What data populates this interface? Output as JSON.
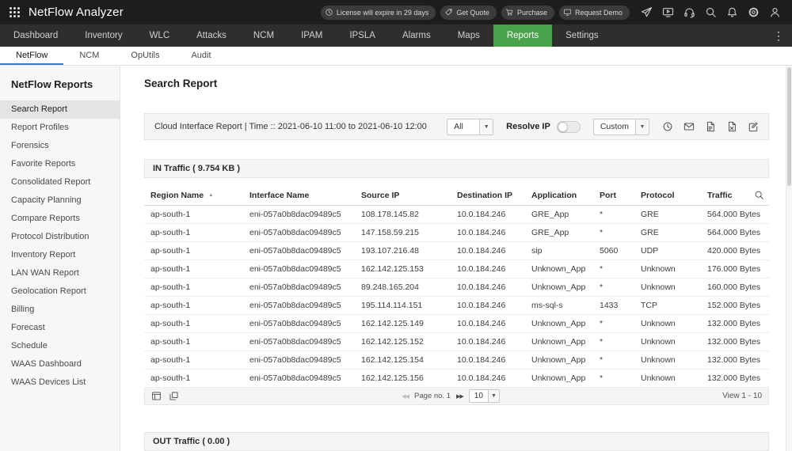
{
  "colors": {
    "accent-green": "#4aa34a",
    "tab-underline": "#3c79c0",
    "topbar-bg": "#1d1d1d",
    "nav-bg": "#2e2e2e"
  },
  "header": {
    "app_title": "NetFlow Analyzer",
    "badges": [
      {
        "label": "License will expire in 29 days",
        "icon": "clock-icon"
      },
      {
        "label": "Get Quote",
        "icon": "quote-tag-icon"
      },
      {
        "label": "Purchase",
        "icon": "cart-icon"
      },
      {
        "label": "Request Demo",
        "icon": "demo-monitor-icon"
      }
    ],
    "icons": [
      "send-icon",
      "screen-share-icon",
      "headset-icon",
      "search-icon",
      "bell-icon",
      "gear-icon",
      "user-icon"
    ]
  },
  "nav": {
    "items": [
      "Dashboard",
      "Inventory",
      "WLC",
      "Attacks",
      "NCM",
      "IPAM",
      "IPSLA",
      "Alarms",
      "Maps",
      "Reports",
      "Settings"
    ],
    "active": "Reports"
  },
  "subnav": {
    "items": [
      "NetFlow",
      "NCM",
      "OpUtils",
      "Audit"
    ],
    "active": "NetFlow"
  },
  "sidebar": {
    "title": "NetFlow Reports",
    "items": [
      "Search Report",
      "Report Profiles",
      "Forensics",
      "Favorite Reports",
      "Consolidated Report",
      "Capacity Planning",
      "Compare Reports",
      "Protocol Distribution",
      "Inventory Report",
      "LAN WAN Report",
      "Geolocation Report",
      "Billing",
      "Forecast",
      "Schedule",
      "WAAS Dashboard",
      "WAAS Devices List"
    ],
    "active": "Search Report"
  },
  "main": {
    "page_title": "Search Report",
    "toolbar": {
      "report_title": "Cloud Interface Report | Time :: 2021-06-10 11:00 to 2021-06-10 12:00",
      "filter_value": "All",
      "resolve_ip_label": "Resolve IP",
      "resolve_ip_on": false,
      "range_value": "Custom",
      "icons": [
        "clock-icon",
        "email-icon",
        "pdf-export-icon",
        "csv-export-icon",
        "edit-icon"
      ]
    },
    "in_traffic": {
      "title": "IN Traffic ( 9.754 KB )",
      "columns": [
        "Region Name",
        "Interface Name",
        "Source IP",
        "Destination IP",
        "Application",
        "Port",
        "Protocol",
        "Traffic"
      ],
      "rows": [
        [
          "ap-south-1",
          "eni-057a0b8dac09489c5",
          "108.178.145.82",
          "10.0.184.246",
          "GRE_App",
          "*",
          "GRE",
          "564.000 Bytes"
        ],
        [
          "ap-south-1",
          "eni-057a0b8dac09489c5",
          "147.158.59.215",
          "10.0.184.246",
          "GRE_App",
          "*",
          "GRE",
          "564.000 Bytes"
        ],
        [
          "ap-south-1",
          "eni-057a0b8dac09489c5",
          "193.107.216.48",
          "10.0.184.246",
          "sip",
          "5060",
          "UDP",
          "420.000 Bytes"
        ],
        [
          "ap-south-1",
          "eni-057a0b8dac09489c5",
          "162.142.125.153",
          "10.0.184.246",
          "Unknown_App",
          "*",
          "Unknown",
          "176.000 Bytes"
        ],
        [
          "ap-south-1",
          "eni-057a0b8dac09489c5",
          "89.248.165.204",
          "10.0.184.246",
          "Unknown_App",
          "*",
          "Unknown",
          "160.000 Bytes"
        ],
        [
          "ap-south-1",
          "eni-057a0b8dac09489c5",
          "195.114.114.151",
          "10.0.184.246",
          "ms-sql-s",
          "1433",
          "TCP",
          "152.000 Bytes"
        ],
        [
          "ap-south-1",
          "eni-057a0b8dac09489c5",
          "162.142.125.149",
          "10.0.184.246",
          "Unknown_App",
          "*",
          "Unknown",
          "132.000 Bytes"
        ],
        [
          "ap-south-1",
          "eni-057a0b8dac09489c5",
          "162.142.125.152",
          "10.0.184.246",
          "Unknown_App",
          "*",
          "Unknown",
          "132.000 Bytes"
        ],
        [
          "ap-south-1",
          "eni-057a0b8dac09489c5",
          "162.142.125.154",
          "10.0.184.246",
          "Unknown_App",
          "*",
          "Unknown",
          "132.000 Bytes"
        ],
        [
          "ap-south-1",
          "eni-057a0b8dac09489c5",
          "162.142.125.156",
          "10.0.184.246",
          "Unknown_App",
          "*",
          "Unknown",
          "132.000 Bytes"
        ]
      ],
      "pagination": {
        "icons": [
          "report-list-icon",
          "export-icon"
        ],
        "page_label": "Page no. 1",
        "page_size": "10",
        "view_label": "View 1 - 10"
      }
    },
    "out_traffic": {
      "title": "OUT Traffic ( 0.00 )"
    }
  }
}
